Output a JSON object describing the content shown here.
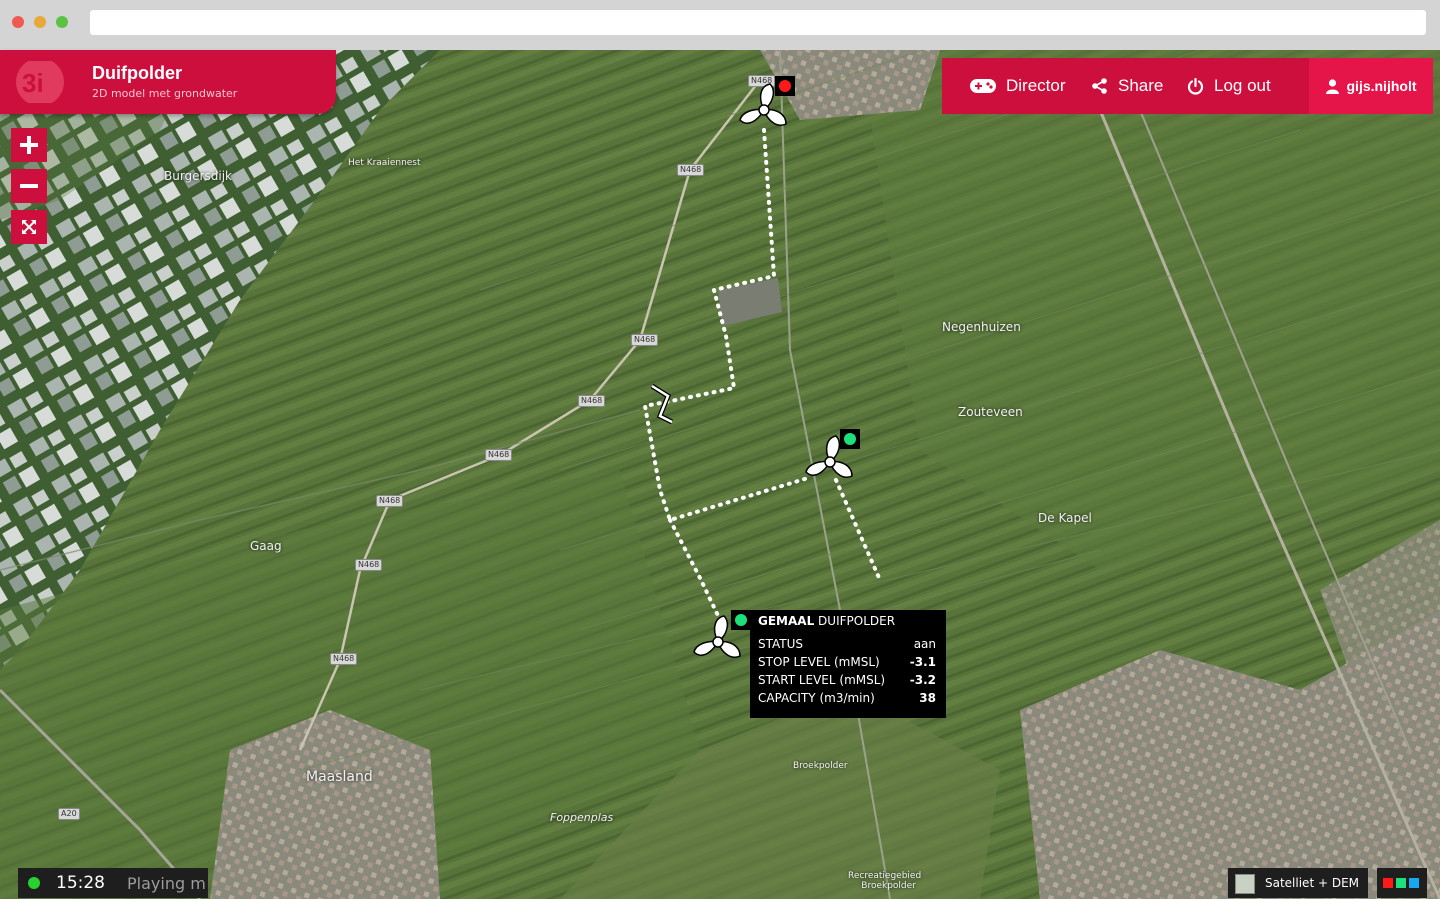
{
  "model": {
    "title": "Duifpolder",
    "subtitle": "2D model met grondwater"
  },
  "zoom": {
    "in_icon": "plus-icon",
    "out_icon": "minus-icon",
    "extent_icon": "expand-icon"
  },
  "nav": {
    "director_label": "Director",
    "share_label": "Share",
    "logout_label": "Log out",
    "user_label": "gijs.nijholt",
    "colors": {
      "bar": "#cc0f3d",
      "user": "#e5154a"
    }
  },
  "map": {
    "places": {
      "burgersdijk": "Burgersdijk",
      "kraaiennest": "Het Kraaiennest",
      "negenhuizen": "Negenhuizen",
      "zouteveen": "Zouteveen",
      "dekapel": "De Kapel",
      "gaag": "Gaag",
      "maasland": "Maasland",
      "broekpolder": "Broekpolder",
      "foppenplas": "Foppenplas",
      "recreatie1": "Recreatiegebied",
      "recreatie2": "Broekpolder"
    },
    "roads": {
      "n468": "N468",
      "a20": "A20"
    }
  },
  "pumps": [
    {
      "name": "pump-north",
      "status_color": "#ff1a1a"
    },
    {
      "name": "pump-middle",
      "status_color": "#1ee07a"
    },
    {
      "name": "pump-duifpolder",
      "status_color": "#1ee07a"
    }
  ],
  "popup": {
    "title_bold": "GEMAAL",
    "title_rest": "DUIFPOLDER",
    "rows": [
      {
        "label": "STATUS",
        "value": "aan"
      },
      {
        "label": "STOP LEVEL (mMSL)",
        "value": "-3.1"
      },
      {
        "label": "START LEVEL (mMSL)",
        "value": "-3.2"
      },
      {
        "label": "CAPACITY (m3/min)",
        "value": "38"
      }
    ]
  },
  "status": {
    "time": "15:28",
    "mode": "Playing m",
    "led_color": "#27d22e"
  },
  "layer": {
    "label": "Satelliet + DEM",
    "legend_colors": [
      "#ff1a1a",
      "#1ee07a",
      "#18a8f0"
    ]
  }
}
